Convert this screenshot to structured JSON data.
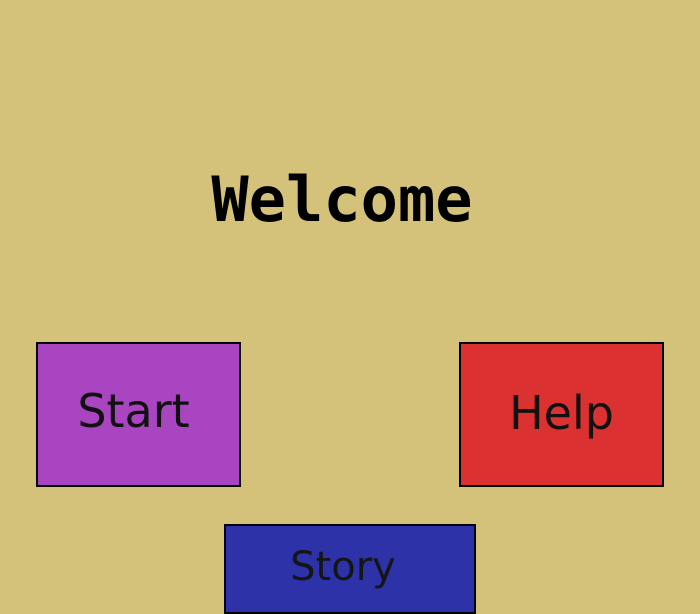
{
  "title": "Welcome",
  "background_color": "#d4c17a",
  "buttons": {
    "start": {
      "label": "Start",
      "color": "#a945c1"
    },
    "help": {
      "label": "Help",
      "color": "#dc3131"
    },
    "story": {
      "label": "Story",
      "color": "#2e32a8"
    }
  }
}
